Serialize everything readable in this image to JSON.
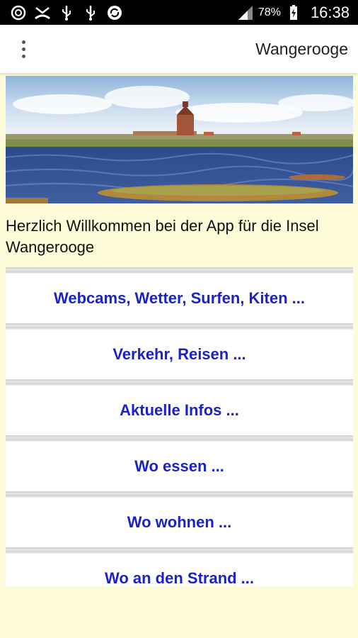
{
  "status_bar": {
    "icons": [
      "instagram-like-icon",
      "missed-call-icon",
      "usb-debug-icon",
      "usb-debug-icon",
      "sync-icon"
    ],
    "battery": "78%",
    "time": "16:38"
  },
  "app_bar": {
    "title": "Wangerooge",
    "menu_icon": "overflow-menu-icon"
  },
  "hero": {
    "image_desc_icon": "island-lighthouse-photo"
  },
  "welcome_text": "Herzlich Willkommen bei der App für die Insel Wangerooge",
  "menu": {
    "items": [
      {
        "label": "Webcams, Wetter, Surfen, Kiten ..."
      },
      {
        "label": "Verkehr, Reisen ..."
      },
      {
        "label": "Aktuelle Infos ..."
      },
      {
        "label": "Wo essen ..."
      },
      {
        "label": "Wo wohnen ..."
      },
      {
        "label": "Wo an den Strand ..."
      }
    ]
  },
  "colors": {
    "background": "#fdfbd8",
    "link": "#1a23c9",
    "status_bar": "#000000"
  }
}
